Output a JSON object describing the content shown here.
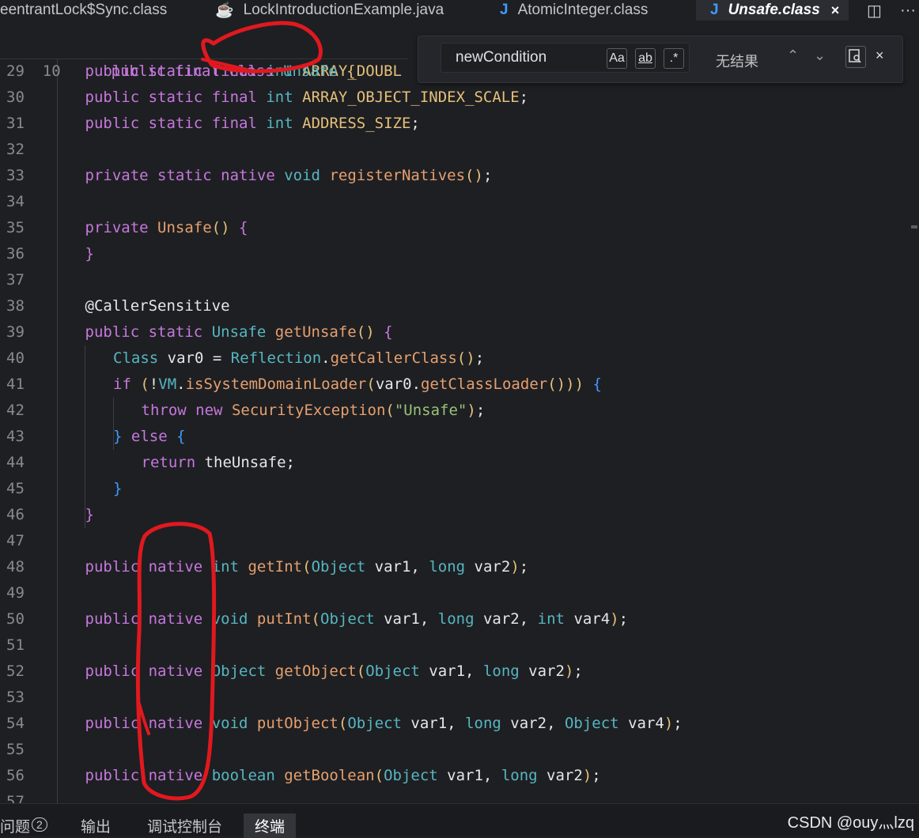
{
  "tabs": [
    {
      "icon": "",
      "label": "eentrantLock$Sync.class"
    },
    {
      "icon": "☕",
      "label": "LockIntroductionExample.java"
    },
    {
      "icon": "J",
      "label": "AtomicInteger.class"
    },
    {
      "icon": "J",
      "label": "Unsafe.class",
      "close": "×"
    }
  ],
  "toolbar": {
    "split_icon": "◫",
    "more": "···"
  },
  "sticky": {
    "num": "10",
    "code": [
      "public",
      " ",
      "final",
      " ",
      "class",
      " ",
      "Unsafe",
      " ",
      "{"
    ]
  },
  "find": {
    "value": "newCondition",
    "opt_case": "Aa",
    "opt_word": "ab",
    "opt_regex": ".*",
    "result": "无结果",
    "prev": "⌃",
    "next": "⌄",
    "close": "×"
  },
  "lines": [
    {
      "n": "29",
      "t": [
        "public static final int ARRAY_DOUBL"
      ]
    },
    {
      "n": "30",
      "t": [
        "public static final int ARRAY_OBJECT_INDEX_SCALE;"
      ]
    },
    {
      "n": "31",
      "t": [
        "public static final int ADDRESS_SIZE;"
      ]
    },
    {
      "n": "32",
      "t": [
        ""
      ]
    },
    {
      "n": "33",
      "t": [
        "private static native void registerNatives();"
      ]
    },
    {
      "n": "34",
      "t": [
        ""
      ]
    },
    {
      "n": "35",
      "t": [
        "private Unsafe() {"
      ]
    },
    {
      "n": "36",
      "t": [
        "}"
      ]
    },
    {
      "n": "37",
      "t": [
        ""
      ]
    },
    {
      "n": "38",
      "t": [
        "@CallerSensitive"
      ]
    },
    {
      "n": "39",
      "t": [
        "public static Unsafe getUnsafe() {"
      ]
    },
    {
      "n": "40",
      "t": [
        "Class var0 = Reflection.getCallerClass();"
      ]
    },
    {
      "n": "41",
      "t": [
        "if (!VM.isSystemDomainLoader(var0.getClassLoader())) {"
      ]
    },
    {
      "n": "42",
      "t": [
        "throw new SecurityException(\"Unsafe\");"
      ]
    },
    {
      "n": "43",
      "t": [
        "} else {"
      ]
    },
    {
      "n": "44",
      "t": [
        "return theUnsafe;"
      ]
    },
    {
      "n": "45",
      "t": [
        "}"
      ]
    },
    {
      "n": "46",
      "t": [
        "}"
      ]
    },
    {
      "n": "47",
      "t": [
        ""
      ]
    },
    {
      "n": "48",
      "t": [
        "public native int getInt(Object var1, long var2);"
      ]
    },
    {
      "n": "49",
      "t": [
        ""
      ]
    },
    {
      "n": "50",
      "t": [
        "public native void putInt(Object var1, long var2, int var4);"
      ]
    },
    {
      "n": "51",
      "t": [
        ""
      ]
    },
    {
      "n": "52",
      "t": [
        "public native Object getObject(Object var1, long var2);"
      ]
    },
    {
      "n": "53",
      "t": [
        ""
      ]
    },
    {
      "n": "54",
      "t": [
        "public native void putObject(Object var1, long var2, Object var4);"
      ]
    },
    {
      "n": "55",
      "t": [
        ""
      ]
    },
    {
      "n": "56",
      "t": [
        "public native boolean getBoolean(Object var1, long var2);"
      ]
    },
    {
      "n": "57",
      "t": [
        ""
      ]
    }
  ],
  "bottom_tabs": [
    "问题",
    "输出",
    "调试控制台",
    "终端"
  ],
  "bottom_badge": "2",
  "watermark": "CSDN @ouy灬lzq",
  "colors": {
    "keyword": "#c678dd",
    "type": "#56b6c2",
    "function": "#e5a070",
    "constant": "#e5c07b",
    "string": "#98c379",
    "annotation_ink": "#e0191f"
  }
}
